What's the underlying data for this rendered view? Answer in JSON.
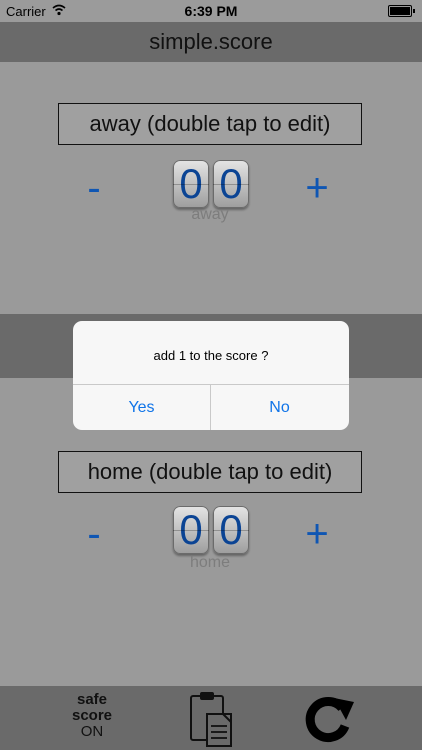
{
  "status_bar": {
    "carrier": "Carrier",
    "time": "6:39 PM"
  },
  "app": {
    "title": "simple.score"
  },
  "away": {
    "label": "away (double tap to edit)",
    "minus": "-",
    "plus": "+",
    "digits": [
      "0",
      "0"
    ],
    "caption": "away"
  },
  "home": {
    "label": "home (double tap to edit)",
    "minus": "-",
    "plus": "+",
    "digits": [
      "0",
      "0"
    ],
    "caption": "home"
  },
  "dialog": {
    "message": "add 1 to the score ?",
    "yes": "Yes",
    "no": "No"
  },
  "bottom": {
    "safe_line1": "safe",
    "safe_line2": "score",
    "safe_state": "ON"
  },
  "icons": {
    "wifi": "wifi-icon",
    "battery": "battery-icon",
    "clipboard": "clipboard-icon",
    "reset": "reset-icon"
  },
  "colors": {
    "accent": "#0f56b3",
    "dialog_button": "#1074e8",
    "digit_text": "#0b4494"
  }
}
